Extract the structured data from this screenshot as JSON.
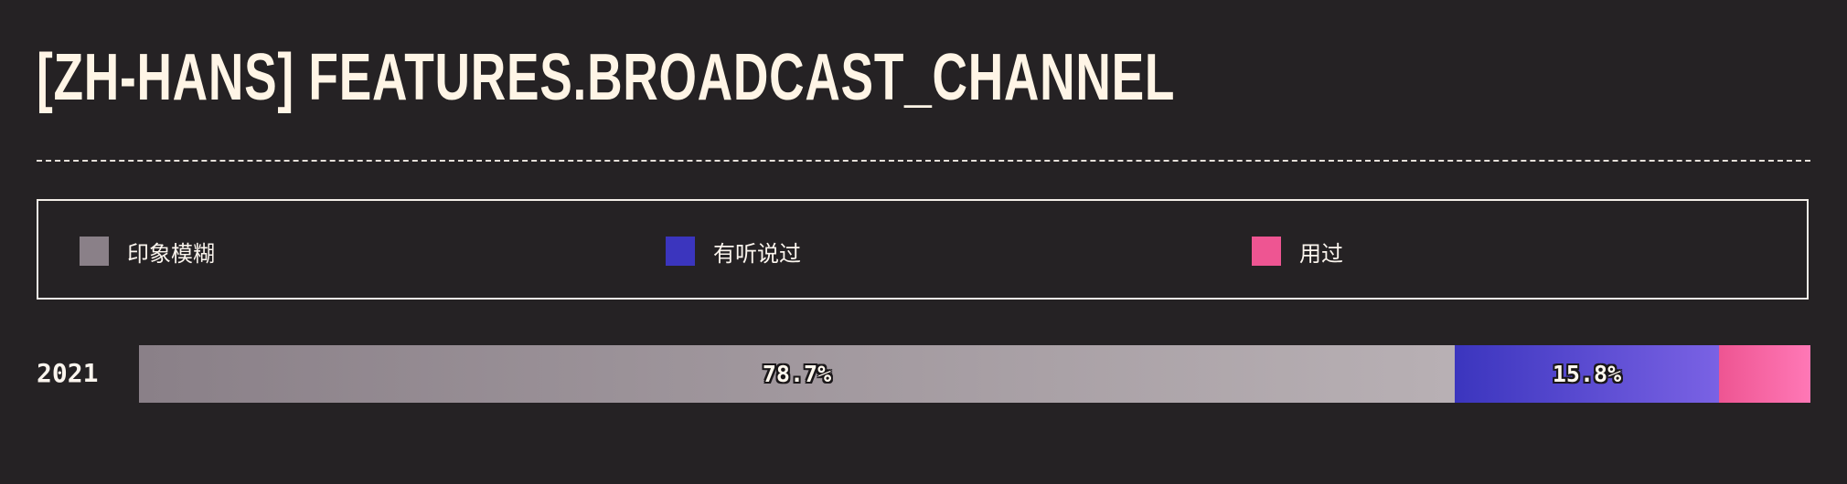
{
  "title": "[ZH-HANS] FEATURES.BROADCAST_CHANNEL",
  "legend": [
    {
      "label": "印象模糊",
      "color": "#8a8088"
    },
    {
      "label": "有听说过",
      "color": "#3b35be"
    },
    {
      "label": "用过",
      "color": "#ee5592"
    }
  ],
  "chart_data": {
    "type": "bar",
    "orientation": "horizontal",
    "stacked": true,
    "categories": [
      "2021"
    ],
    "series": [
      {
        "name": "印象模糊",
        "values": [
          78.7
        ],
        "label": "78.7%",
        "color_start": "#8a8088",
        "color_end": "#b8b0b4"
      },
      {
        "name": "有听说过",
        "values": [
          15.8
        ],
        "label": "15.8%",
        "color_start": "#3b35be",
        "color_end": "#7a62e4"
      },
      {
        "name": "用过",
        "values": [
          5.5
        ],
        "label": "",
        "color_start": "#ee5592",
        "color_end": "#ff78b6"
      }
    ],
    "unit": "%"
  }
}
